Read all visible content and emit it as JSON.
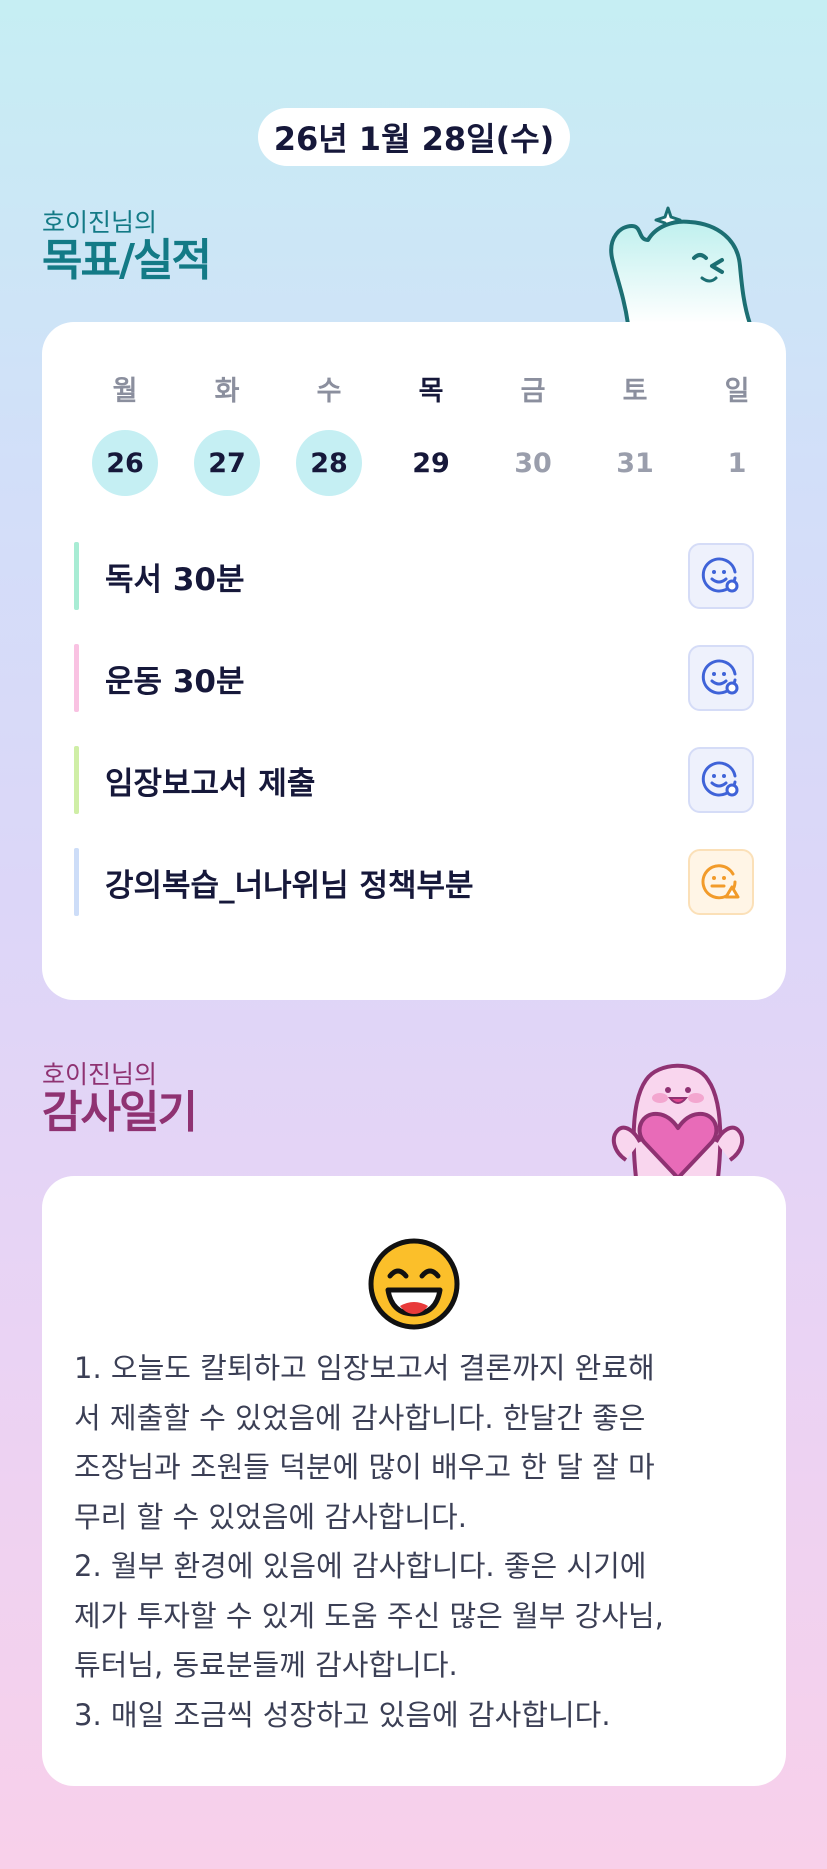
{
  "header": {
    "date": "26년 1월 28일(수)"
  },
  "goals_section": {
    "subtitle": "호이진님의",
    "title": "목표/실적",
    "weekdays": [
      {
        "label": "월",
        "date": "26",
        "done": true,
        "today": false
      },
      {
        "label": "화",
        "date": "27",
        "done": true,
        "today": false
      },
      {
        "label": "수",
        "date": "28",
        "done": true,
        "today": false
      },
      {
        "label": "목",
        "date": "29",
        "done": false,
        "today": true
      },
      {
        "label": "금",
        "date": "30",
        "done": false,
        "today": false
      },
      {
        "label": "토",
        "date": "31",
        "done": false,
        "today": false
      },
      {
        "label": "일",
        "date": "1",
        "done": false,
        "today": false
      }
    ],
    "goals": [
      {
        "title": "독서 30분",
        "bar_color": "#a8ecd4",
        "status": "smile-check-icon",
        "status_color": "#3f63d8"
      },
      {
        "title": "운동 30분",
        "bar_color": "#f9c2e2",
        "status": "smile-check-icon",
        "status_color": "#3f63d8"
      },
      {
        "title": "임장보고서 제출",
        "bar_color": "#cfeea6",
        "status": "smile-check-icon",
        "status_color": "#3f63d8"
      },
      {
        "title": "강의복습_너나위님 정책부분",
        "bar_color": "#cdddf8",
        "status": "smile-warning-icon",
        "status_color": "#f29b2a"
      }
    ]
  },
  "gratitude_section": {
    "subtitle": "호이진님의",
    "title": "감사일기",
    "emoji": "grinning-face-icon",
    "lines": [
      "1. 오늘도 칼퇴하고 임장보고서 결론까지 완료해",
      "서 제출할 수 있었음에 감사합니다. 한달간 좋은",
      "조장님과 조원들 덕분에 많이 배우고 한 달 잘 마",
      "무리 할 수 있었음에 감사합니다.",
      "2. 월부 환경에 있음에 감사합니다. 좋은 시기에",
      "제가 투자할 수 있게 도움 주신 많은 월부 강사님,",
      "튜터님, 동료분들께 감사합니다.",
      "3. 매일 조금씩 성장하고 있음에 감사합니다."
    ]
  },
  "colors": {
    "goal_heading": "#137a86",
    "gratitude_heading": "#8f3272",
    "done_circle": "#c5eff3"
  }
}
